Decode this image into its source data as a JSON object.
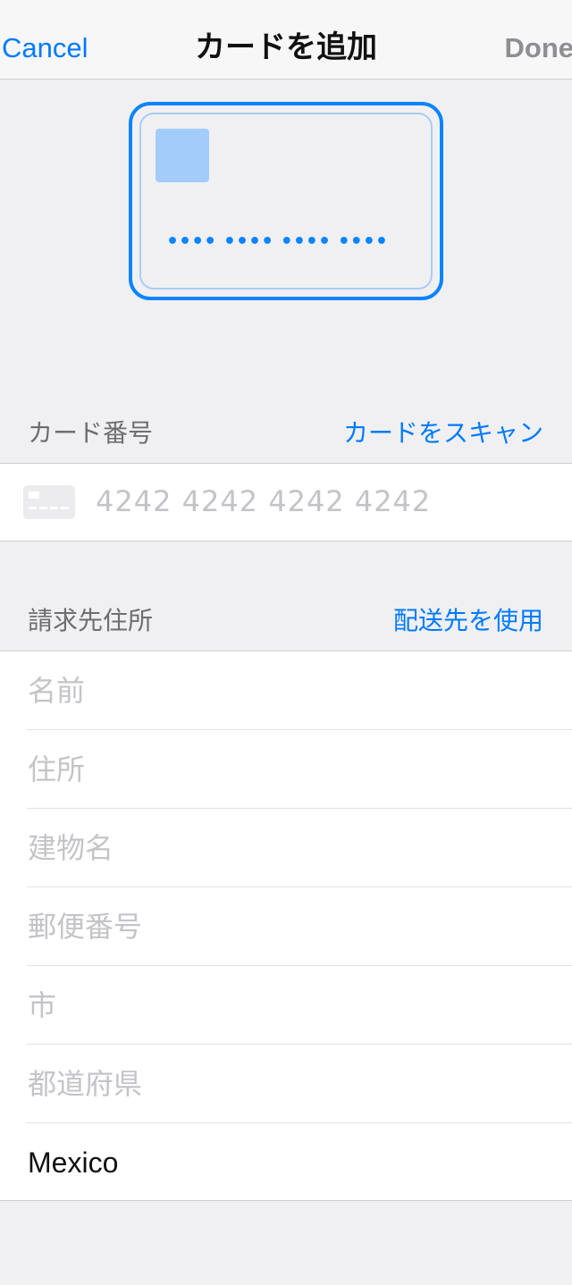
{
  "nav": {
    "cancel_label": "Cancel",
    "title": "カードを追加",
    "done_label": "Done"
  },
  "card_preview": {
    "number_mask": "•••• •••• •••• ••••"
  },
  "card_section": {
    "header_label": "カード番号",
    "action_label": "カードをスキャン",
    "number_placeholder": "4242 4242 4242 4242"
  },
  "billing_section": {
    "header_label": "請求先住所",
    "action_label": "配送先を使用",
    "fields": [
      {
        "placeholder": "名前",
        "value": ""
      },
      {
        "placeholder": "住所",
        "value": ""
      },
      {
        "placeholder": "建物名",
        "value": ""
      },
      {
        "placeholder": "郵便番号",
        "value": ""
      },
      {
        "placeholder": "市",
        "value": ""
      },
      {
        "placeholder": "都道府県",
        "value": ""
      },
      {
        "placeholder": "",
        "value": "Mexico"
      }
    ]
  },
  "colors": {
    "accent": "#007aff",
    "background": "#f0f0f2",
    "placeholder": "#c4c4c8"
  },
  "icons": [
    "card-placeholder-icon"
  ]
}
